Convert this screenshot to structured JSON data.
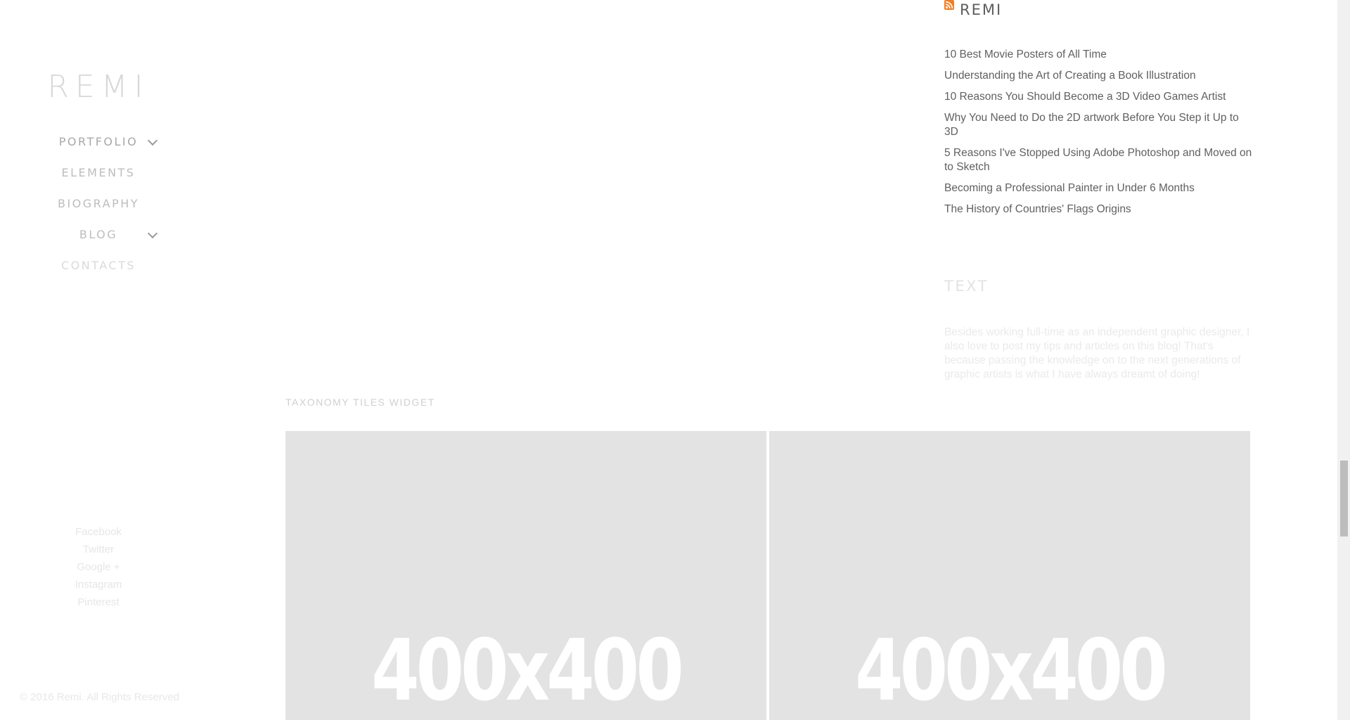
{
  "sidebar": {
    "logo": "REMI",
    "nav": [
      {
        "label": "PORTFOLIO",
        "has_submenu": true
      },
      {
        "label": "ELEMENTS",
        "has_submenu": false
      },
      {
        "label": "BIOGRAPHY",
        "has_submenu": false
      },
      {
        "label": "BLOG",
        "has_submenu": true
      },
      {
        "label": "CONTACTS",
        "has_submenu": false
      }
    ],
    "social": [
      "Facebook",
      "Twitter",
      "Google +",
      "Instagram",
      "Pinterest"
    ],
    "copyright": "© 2016 Remi. All Rights Reserved"
  },
  "rss_widget": {
    "icon": "rss-icon",
    "icon_color": "#f47c22",
    "title": "REMI",
    "posts": [
      "10 Best Movie Posters of All Time",
      "Understanding the Art of Creating a Book Illustration",
      "10 Reasons You Should Become a 3D Video Games Artist",
      "Why You Need to Do the 2D artwork Before You Step it Up to 3D",
      "5 Reasons I've Stopped Using Adobe Photoshop and Moved on to Sketch",
      "Becoming a Professional Painter in Under 6 Months",
      "The History of Countries' Flags Origins"
    ]
  },
  "text_widget": {
    "title": "TEXT",
    "body": "Besides working full-time as an independent graphic designer, I also love to post my tips and articles on this blog! That's because passing the knowledge on to the next generations of graphic artists is what I have always dreamt of doing!"
  },
  "taxonomy": {
    "title": "TAXONOMY TILES WIDGET",
    "tiles": [
      {
        "label": "400x400"
      },
      {
        "label": "400x400"
      }
    ]
  }
}
